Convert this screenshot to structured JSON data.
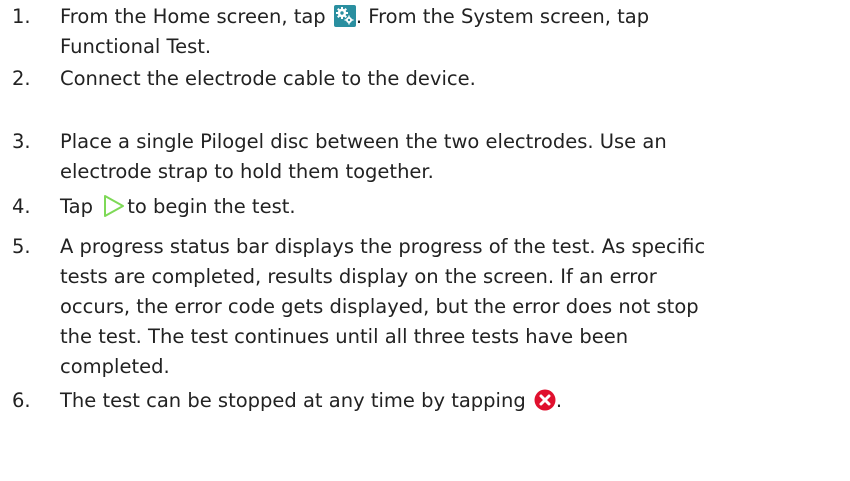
{
  "steps": [
    {
      "number": "1.",
      "lines": [
        {
          "before": "From the Home screen, tap ",
          "icon": "gear-icon",
          "after": ". From the System screen, tap"
        },
        {
          "text": "Functional Test."
        }
      ]
    },
    {
      "number": "2.",
      "lines": [
        {
          "text": "Connect the electrode cable to the device."
        }
      ]
    },
    {
      "number": "3.",
      "lines": [
        {
          "text": "Place a single Pilogel disc between the two electrodes. Use an"
        },
        {
          "text": "electrode strap to hold them together."
        }
      ]
    },
    {
      "number": "4.",
      "lines": [
        {
          "before": "Tap ",
          "icon": "play-icon",
          "after": "to begin the test."
        }
      ]
    },
    {
      "number": "5.",
      "lines": [
        {
          "text": "A progress status bar displays the progress of the test. As specific"
        },
        {
          "text": "tests are completed, results display on the screen. If an error"
        },
        {
          "text": "occurs, the error code gets displayed, but the error does not stop"
        },
        {
          "text": "the test. The test continues until all three tests have been"
        },
        {
          "text": "completed."
        }
      ]
    },
    {
      "number": "6.",
      "lines": [
        {
          "before": "The test can be stopped at any time by tapping ",
          "icon": "close-icon",
          "after": "."
        }
      ]
    }
  ],
  "colors": {
    "gear_background": "#2a8fa0",
    "play_stroke": "#7ed957",
    "close_fill": "#e0102e"
  }
}
